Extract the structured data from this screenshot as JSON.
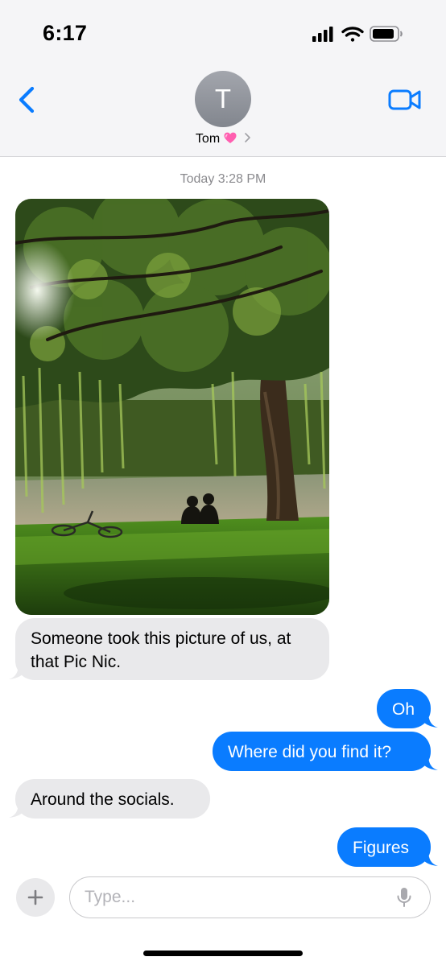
{
  "status_bar": {
    "time": "6:17"
  },
  "header": {
    "back_icon": "chevron-left-icon",
    "avatar_initial": "T",
    "contact_name": "Tom",
    "contact_emoji": "pink-heart-icon",
    "video_icon": "video-camera-icon",
    "accent_color": "#0a7cff"
  },
  "conversation": {
    "timestamp": "Today 3:28 PM",
    "photo_description_icon": "photo-attachment",
    "messages": [
      {
        "direction": "in",
        "text": "Someone took this picture of us, at that Pic Nic."
      },
      {
        "direction": "out",
        "text": "Oh"
      },
      {
        "direction": "out",
        "text": "Where did you find it?"
      },
      {
        "direction": "in",
        "text": "Around the socials."
      },
      {
        "direction": "out",
        "text": "Figures"
      }
    ]
  },
  "composer": {
    "plus_icon": "plus-icon",
    "placeholder": "Type...",
    "mic_icon": "microphone-icon"
  },
  "colors": {
    "incoming_bubble": "#e9e9eb",
    "outgoing_bubble": "#0a7cff",
    "header_bg": "#f5f5f7"
  }
}
